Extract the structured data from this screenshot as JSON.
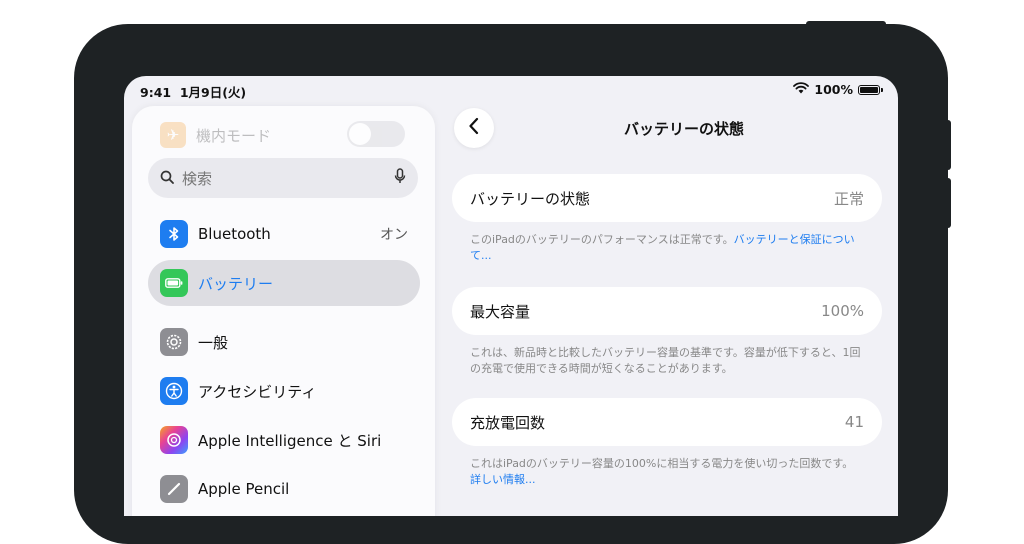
{
  "status_bar": {
    "time": "9:41",
    "date": "1月9日(火)",
    "battery_pct": "100%"
  },
  "sidebar": {
    "airplane_label": "機内モード",
    "search_placeholder": "検索",
    "items": [
      {
        "label": "Bluetooth",
        "value": "オン",
        "icon": "bluetooth-icon",
        "color": "#1e7df0"
      },
      {
        "label": "バッテリー",
        "icon": "battery-icon",
        "color": "#34c759",
        "selected": true
      },
      {
        "label": "一般",
        "icon": "gear-icon",
        "color": "#8e8e93"
      },
      {
        "label": "アクセシビリティ",
        "icon": "accessibility-icon",
        "color": "#1e7df0"
      },
      {
        "label": "Apple Intelligence と Siri",
        "icon": "siri-icon",
        "color": "#b36be8"
      },
      {
        "label": "Apple Pencil",
        "icon": "pencil-icon",
        "color": "#8e8e93"
      }
    ]
  },
  "detail": {
    "title": "バッテリーの状態",
    "rows": [
      {
        "label": "バッテリーの状態",
        "value": "正常",
        "desc": "このiPadのバッテリーのパフォーマンスは正常です。",
        "link": "バッテリーと保証について..."
      },
      {
        "label": "最大容量",
        "value": "100%",
        "desc": "これは、新品時と比較したバッテリー容量の基準です。容量が低下すると、1回の充電で使用できる時間が短くなることがあります。"
      },
      {
        "label": "充放電回数",
        "value": "41",
        "desc": "これはiPadのバッテリー容量の100%に相当する電力を使い切った回数です。",
        "link": "詳しい情報..."
      }
    ]
  },
  "colors": {
    "accent": "#1e7df0",
    "bezel": "#1e2224",
    "background": "#f1f1f6"
  }
}
